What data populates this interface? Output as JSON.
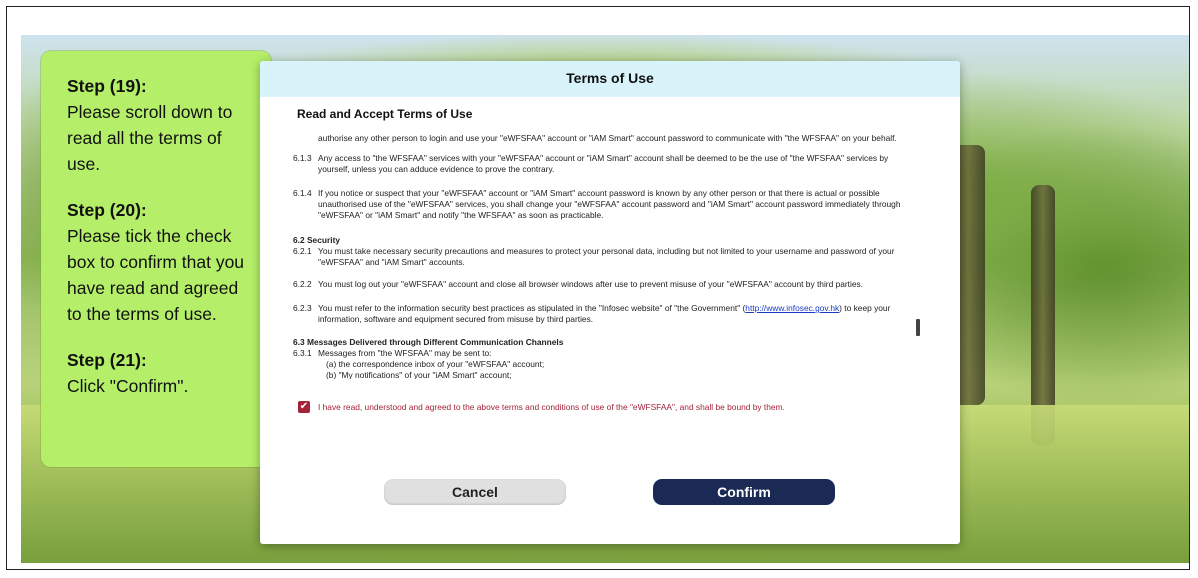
{
  "callout": {
    "step19_title": "Step (19):",
    "step19_text": "Please scroll down to read all the terms of use.",
    "step20_title": "Step (20):",
    "step20_text": "Please tick the check box to confirm that you have read and agreed to the terms of use.",
    "step21_title": "Step (21):",
    "step21_text": "Click \"Confirm\"."
  },
  "modal": {
    "title": "Terms of Use",
    "subtitle": "Read and Accept Terms of Use",
    "terms": [
      {
        "num": "",
        "text": "authorise any other person to login and use your \"eWFSFAA\" account or \"iAM Smart\" account password to communicate with \"the WFSFAA\" on your behalf."
      },
      {
        "num": "6.1.3",
        "text": "Any access to \"the WFSFAA\" services with your \"eWFSFAA\" account or \"iAM Smart\" account shall be deemed to be the use of \"the WFSFAA\" services by yourself, unless you can adduce evidence to prove the contrary."
      },
      {
        "num": "6.1.4",
        "text": "If you notice or suspect that your \"eWFSFAA\" account or \"iAM Smart\" account password is known by any other person or that there is actual or possible unauthorised use of the \"eWFSFAA\" services, you shall change your \"eWFSFAA\" account password and \"iAM Smart\" account password immediately through \"eWFSFAA\" or \"iAM Smart\" and notify \"the WFSFAA\" as soon as practicable."
      },
      {
        "heading": "6.2 Security"
      },
      {
        "num": "6.2.1",
        "text": "You must take necessary security precautions and measures to protect your personal data, including but not limited to your username and password of your \"eWFSFAA\" and \"iAM Smart\" accounts."
      },
      {
        "num": "6.2.2",
        "text": "You must log out your \"eWFSFAA\" account and close all browser windows after use to prevent misuse of your \"eWFSFAA\" account by third parties."
      },
      {
        "num": "6.2.3",
        "text_before": "You must refer to the information security best practices as stipulated in the \"Infosec website\" of \"the Government\" (",
        "link": "http://www.infosec.gov.hk",
        "text_after": ") to keep your information, software and equipment secured from misuse by third parties."
      },
      {
        "heading": "6.3 Messages Delivered through Different Communication Channels"
      },
      {
        "num": "6.3.1",
        "text": "Messages from \"the WFSFAA\" may be sent to:"
      },
      {
        "num": "",
        "text": "(a)  the correspondence inbox of your \"eWFSFAA\" account;"
      },
      {
        "num": "",
        "text": "(b)  \"My notifications\" of your \"iAM Smart\" account;"
      }
    ],
    "agree_checked": true,
    "agree_text": "I have read, understood and agreed to the above terms and conditions of use of the \"eWFSFAA\", and shall be bound by them.",
    "cancel_label": "Cancel",
    "confirm_label": "Confirm"
  },
  "colors": {
    "callout_bg": "#b5ef6a",
    "header_bg": "#d9f3fb",
    "confirm_bg": "#1a2a55",
    "agree_red": "#a3243a"
  }
}
